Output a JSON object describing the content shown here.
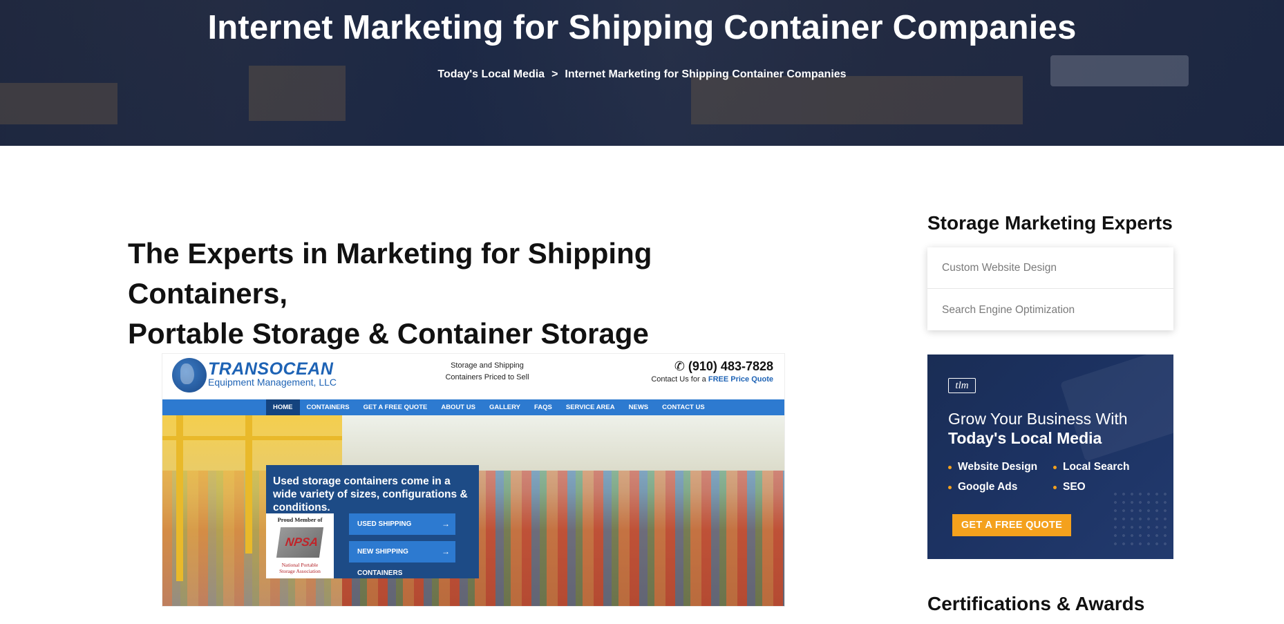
{
  "hero": {
    "title": "Internet Marketing for Shipping Container Companies",
    "breadcrumb": {
      "home": "Today's Local Media",
      "separator": ">",
      "current": "Internet Marketing for Shipping Container Companies"
    }
  },
  "main": {
    "heading_line1": "The Experts in Marketing for Shipping Containers,",
    "heading_line2": "Portable Storage & Container Storage"
  },
  "screenshot": {
    "logo_name": "TRANSOCEAN",
    "logo_sub": "Equipment Management, LLC",
    "tagline_line1": "Storage and Shipping",
    "tagline_line2": "Containers Priced to Sell",
    "phone": "(910) 483-7828",
    "contact_prefix": "Contact Us for a",
    "contact_link": "FREE Price Quote",
    "nav": [
      "HOME",
      "CONTAINERS",
      "GET A FREE QUOTE",
      "ABOUT US",
      "GALLERY",
      "FAQS",
      "SERVICE AREA",
      "NEWS",
      "CONTACT US"
    ],
    "promo_text": "Used storage containers come in a wide variety of sizes, configurations & conditions.",
    "npsa_top": "Proud Member of",
    "npsa_logo": "NPSA",
    "npsa_bottom_line1": "National Portable",
    "npsa_bottom_line2": "Storage Association",
    "button_used": "USED SHIPPING CONTAINERS",
    "button_new": "NEW SHIPPING CONTAINERS"
  },
  "sidebar": {
    "title": "Storage Marketing Experts",
    "services": [
      "Custom Website Design",
      "Search Engine Optimization"
    ],
    "card": {
      "logo": "tlm",
      "line1": "Grow Your Business With",
      "line2": "Today's Local Media",
      "bullets": [
        "Website Design",
        "Local Search",
        "Google Ads",
        "SEO"
      ],
      "cta": "GET A FREE QUOTE",
      "accent_color": "#f4a11d"
    },
    "cert_title": "Certifications & Awards"
  }
}
